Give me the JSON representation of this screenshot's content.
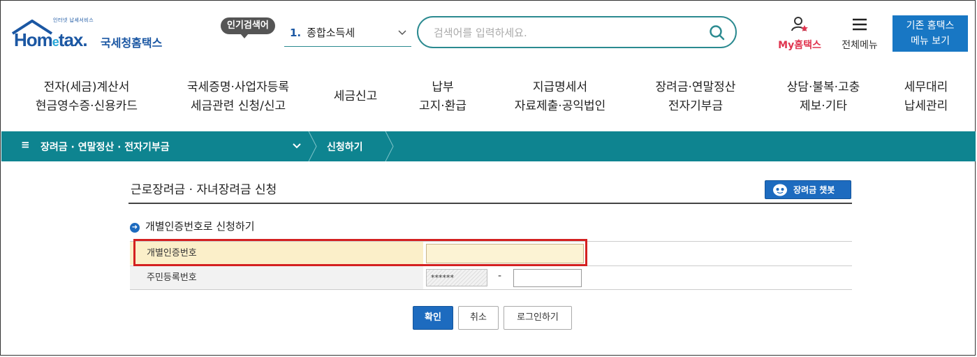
{
  "header": {
    "logo_sub": "인터넷 납세서비스",
    "logo_word_prefix": "Hom",
    "logo_word_e": "e",
    "logo_word_suffix": "tax.",
    "logo_name": "국세청홈택스",
    "popular_badge": "인기검색어",
    "popular_rank": "1.",
    "popular_term": "종합소득세",
    "search_placeholder": "검색어를 입력하세요.",
    "my_hometax": "My홈택스",
    "all_menu": "전체메뉴",
    "old_hometax_line1": "기존 홈택스",
    "old_hometax_line2": "메뉴 보기"
  },
  "gnb": [
    {
      "line1": "전자(세금)계산서",
      "line2": "현금영수증·신용카드"
    },
    {
      "line1": "국세증명·사업자등록",
      "line2": "세금관련 신청/신고"
    },
    {
      "line1": "세금신고",
      "line2": ""
    },
    {
      "line1": "납부",
      "line2": "고지·환급"
    },
    {
      "line1": "지급명세서",
      "line2": "자료제출·공익법인"
    },
    {
      "line1": "장려금·연말정산",
      "line2": "전자기부금"
    },
    {
      "line1": "상담·불복·고충",
      "line2": "제보·기타"
    },
    {
      "line1": "세무대리",
      "line2": "납세관리"
    }
  ],
  "pathbar": {
    "category": "장려금 · 연말정산 · 전자기부금",
    "current": "신청하기"
  },
  "content": {
    "page_title": "근로장려금 · 자녀장려금 신청",
    "chatbot_label": "장려금 챗봇",
    "section_title": "개별인증번호로 신청하기",
    "fields": {
      "cert_label": "개별인증번호",
      "cert_value": "",
      "rrn_label": "주민등록번호",
      "rrn_front_masked": "******",
      "rrn_dash": "-",
      "rrn_back_value": ""
    },
    "buttons": {
      "ok": "확인",
      "cancel": "취소",
      "login": "로그인하기"
    }
  },
  "colors": {
    "brand_blue": "#1b57a3",
    "teal": "#0e8490",
    "accent_red": "#e0354f",
    "button_blue": "#1d6bbf",
    "highlight_red": "#d42020"
  }
}
